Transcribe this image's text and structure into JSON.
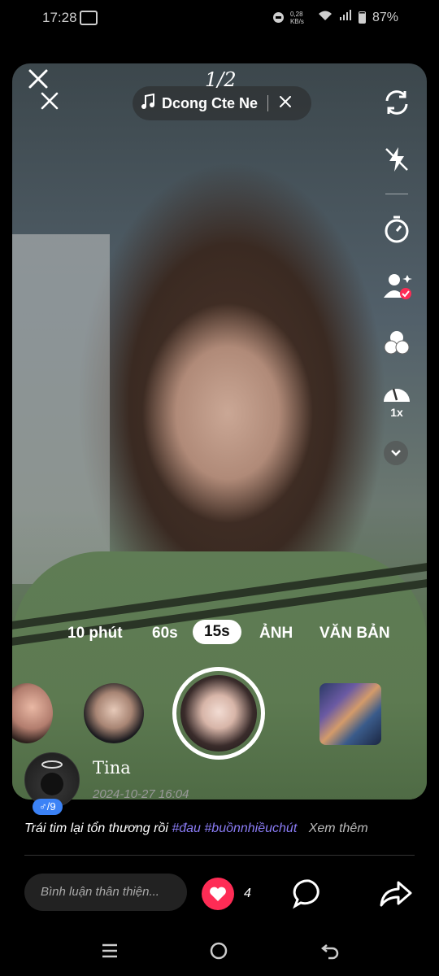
{
  "status_bar": {
    "time": "17:28",
    "speed": "0,28 KB/s",
    "battery": "87%"
  },
  "overlay": {
    "page_indicator": "1/2"
  },
  "sound": {
    "label": "Dcong Cte Ne"
  },
  "side_tools": {
    "speed_label": "1x"
  },
  "modes": [
    "10 phút",
    "60s",
    "15s",
    "ẢNH",
    "VĂN BẢN"
  ],
  "selected_mode": "15s",
  "profile": {
    "name": "Tina",
    "timestamp": "2024-10-27 16:04",
    "badge": "♂/9"
  },
  "caption": {
    "text": "Trái tim lại tổn thương rồi",
    "tags": " #đau #buồnnhiềuchút",
    "more": "Xem thêm"
  },
  "comment": {
    "placeholder": "Bình luận thân thiện..."
  },
  "actions": {
    "like_count": "4"
  },
  "colors": {
    "accent_pink": "#fe2c55",
    "tag_color": "#8a7cf5"
  }
}
